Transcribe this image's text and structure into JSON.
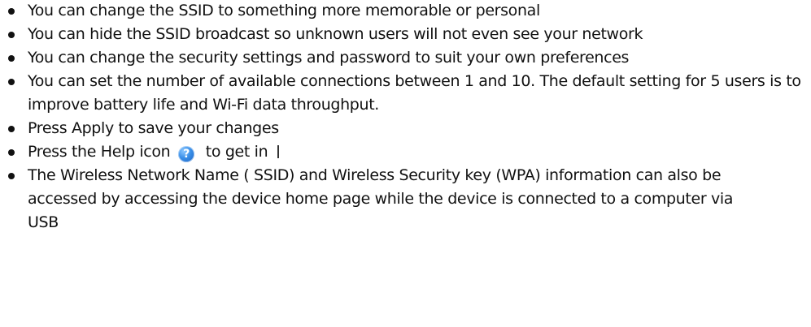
{
  "bullets": [
    {
      "text": "You can change the SSID to something more memorable or personal"
    },
    {
      "text": "You can hide the SSID broadcast so unknown users will not even see your network"
    },
    {
      "text": "You can change the security settings and password to suit your own preferences"
    },
    {
      "text": "You can set the number of available connections between 1 and 10. The default setting for 5 users is to improve battery life and Wi-Fi data throughput."
    },
    {
      "text": "Press Apply to save your changes"
    },
    {
      "text_before_icon": "Press the Help icon",
      "icon": "help-question-icon",
      "icon_glyph": "?",
      "text_after_icon": "to get in"
    },
    {
      "text": "The Wireless Network Name ( SSID) and Wireless Security key (WPA) information can also be accessed by accessing the device home page while the device is connected to a computer via USB"
    }
  ],
  "colors": {
    "text": "#111111",
    "help_icon": "#2f80dc"
  }
}
